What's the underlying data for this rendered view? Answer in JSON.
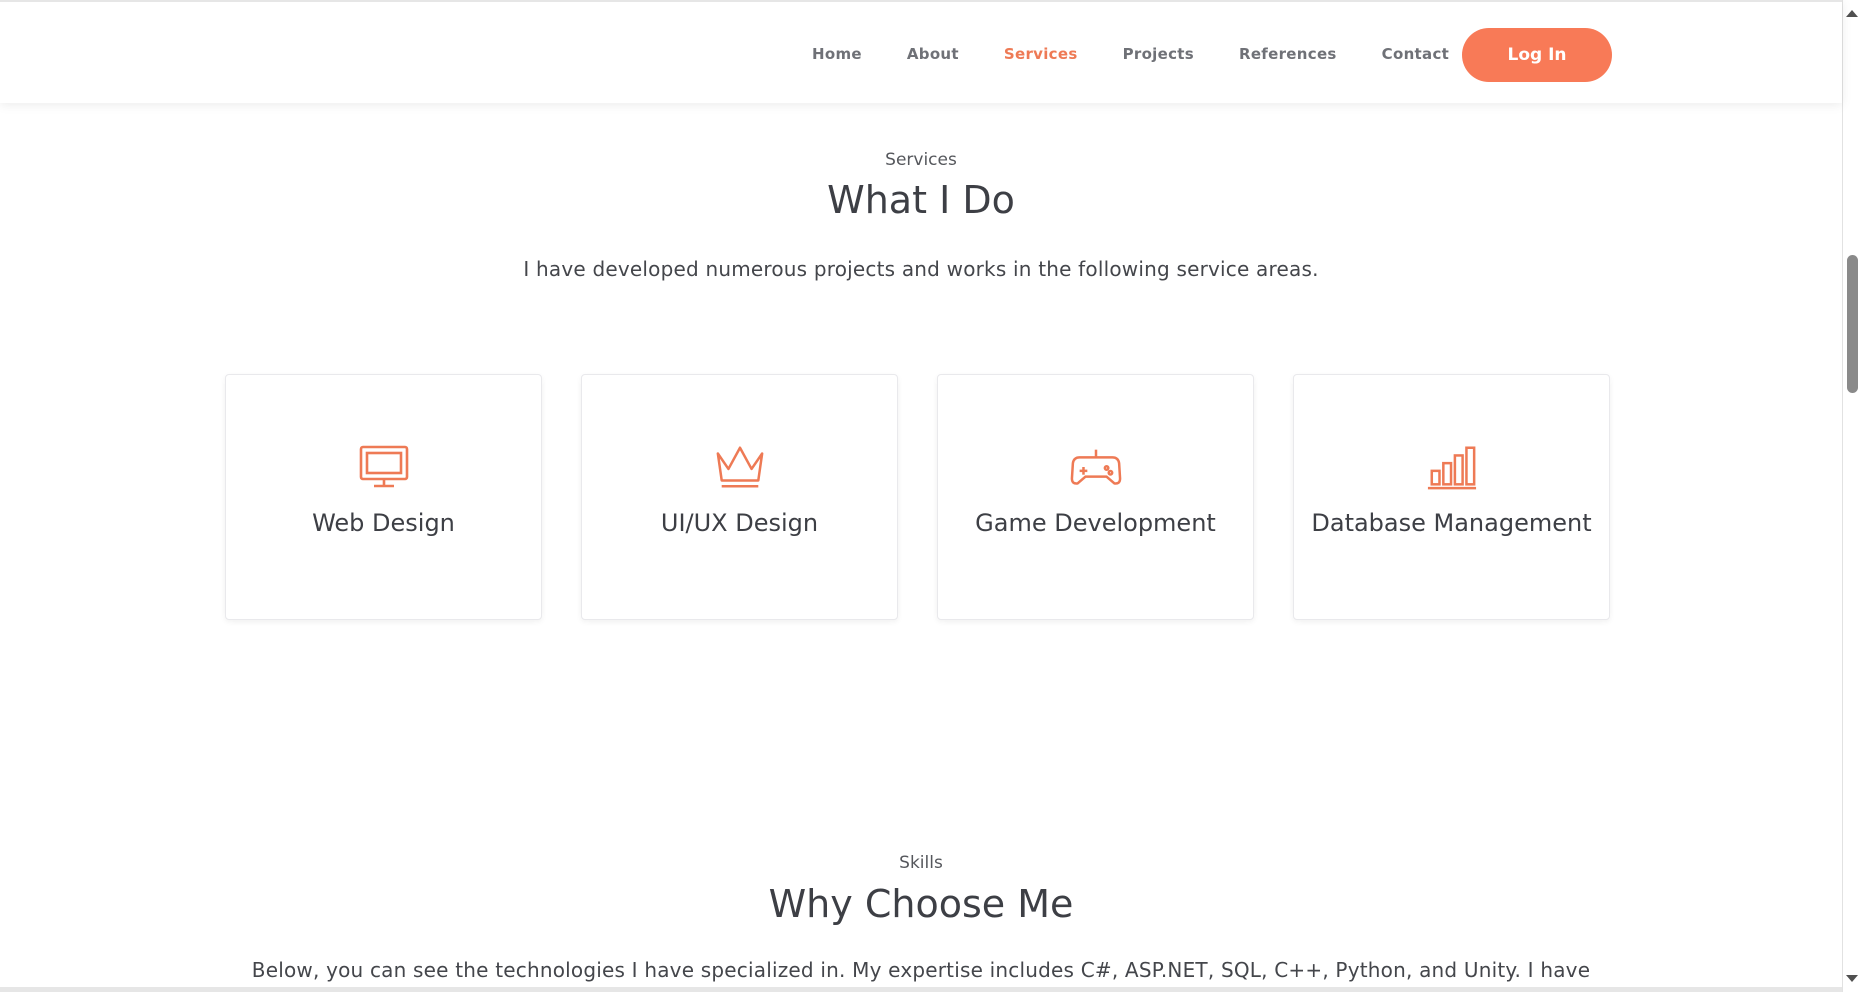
{
  "nav": {
    "items": [
      {
        "label": "Home",
        "active": false
      },
      {
        "label": "About",
        "active": false
      },
      {
        "label": "Services",
        "active": true
      },
      {
        "label": "Projects",
        "active": false
      },
      {
        "label": "References",
        "active": false
      },
      {
        "label": "Contact",
        "active": false
      }
    ],
    "login_label": "Log In"
  },
  "services": {
    "subtitle": "Services",
    "title": "What I Do",
    "description": "I have developed numerous projects and works in the following service areas.",
    "cards": [
      {
        "label": "Web Design",
        "icon": "monitor-icon"
      },
      {
        "label": "UI/UX Design",
        "icon": "crown-icon"
      },
      {
        "label": "Game Development",
        "icon": "gamepad-icon"
      },
      {
        "label": "Database Management",
        "icon": "bar-chart-icon"
      }
    ]
  },
  "skills": {
    "subtitle": "Skills",
    "title": "Why Choose Me",
    "description": "Below, you can see the technologies I have specialized in. My expertise includes C#, ASP.NET, SQL, C++, Python, and Unity. I have"
  },
  "colors": {
    "accent": "#f87a57",
    "active_nav": "#ee7a55",
    "text": "#3d3f45"
  }
}
